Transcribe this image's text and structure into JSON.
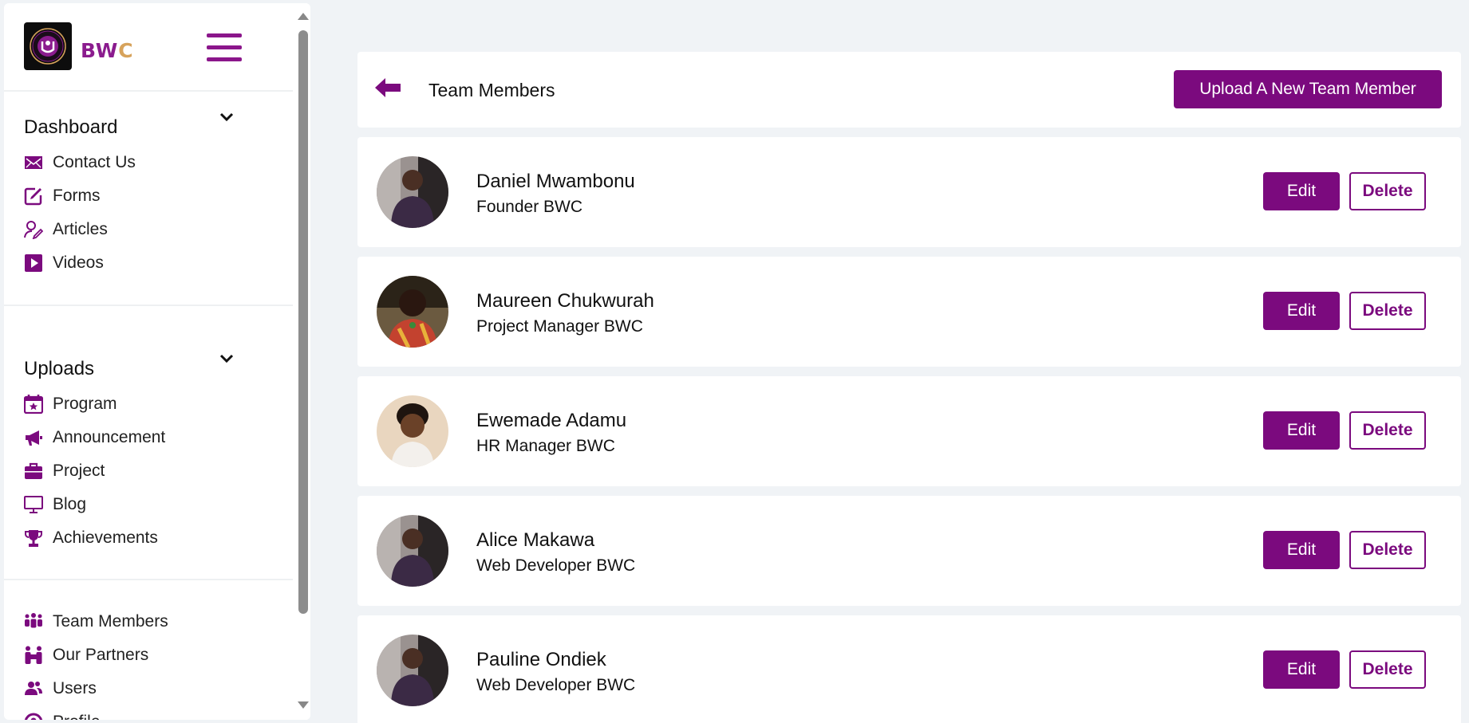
{
  "brand": {
    "name_part1": "B",
    "name_part2": "W",
    "name_part3": "C"
  },
  "sidebar": {
    "dashboard": {
      "title": "Dashboard",
      "items": [
        {
          "label": "Contact Us",
          "icon": "envelope-icon"
        },
        {
          "label": "Forms",
          "icon": "edit-icon"
        },
        {
          "label": "Articles",
          "icon": "user-pen-icon"
        },
        {
          "label": "Videos",
          "icon": "play-icon"
        }
      ]
    },
    "uploads": {
      "title": "Uploads",
      "items": [
        {
          "label": "Program",
          "icon": "calendar-star-icon"
        },
        {
          "label": "Announcement",
          "icon": "megaphone-icon"
        },
        {
          "label": "Project",
          "icon": "briefcase-icon"
        },
        {
          "label": "Blog",
          "icon": "monitor-icon"
        },
        {
          "label": "Achievements",
          "icon": "trophy-icon"
        }
      ]
    },
    "other": {
      "items": [
        {
          "label": "Team Members",
          "icon": "people-group-icon"
        },
        {
          "label": "Our Partners",
          "icon": "people-carry-icon"
        },
        {
          "label": "Users",
          "icon": "users-icon"
        },
        {
          "label": "Profile",
          "icon": "profile-icon"
        }
      ]
    }
  },
  "header": {
    "title": "Team Members",
    "upload_label": "Upload A New Team Member"
  },
  "members": [
    {
      "name": "Daniel Mwambonu",
      "role": "Founder BWC",
      "edit": "Edit",
      "delete": "Delete"
    },
    {
      "name": "Maureen Chukwurah",
      "role": "Project Manager BWC",
      "edit": "Edit",
      "delete": "Delete"
    },
    {
      "name": "Ewemade Adamu",
      "role": "HR Manager BWC",
      "edit": "Edit",
      "delete": "Delete"
    },
    {
      "name": "Alice Makawa",
      "role": "Web Developer BWC",
      "edit": "Edit",
      "delete": "Delete"
    },
    {
      "name": "Pauline Ondiek",
      "role": "Web Developer BWC",
      "edit": "Edit",
      "delete": "Delete"
    }
  ],
  "colors": {
    "accent": "#7b0a7e",
    "brand_gold": "#d7a35c",
    "background": "#f0f3f6"
  }
}
